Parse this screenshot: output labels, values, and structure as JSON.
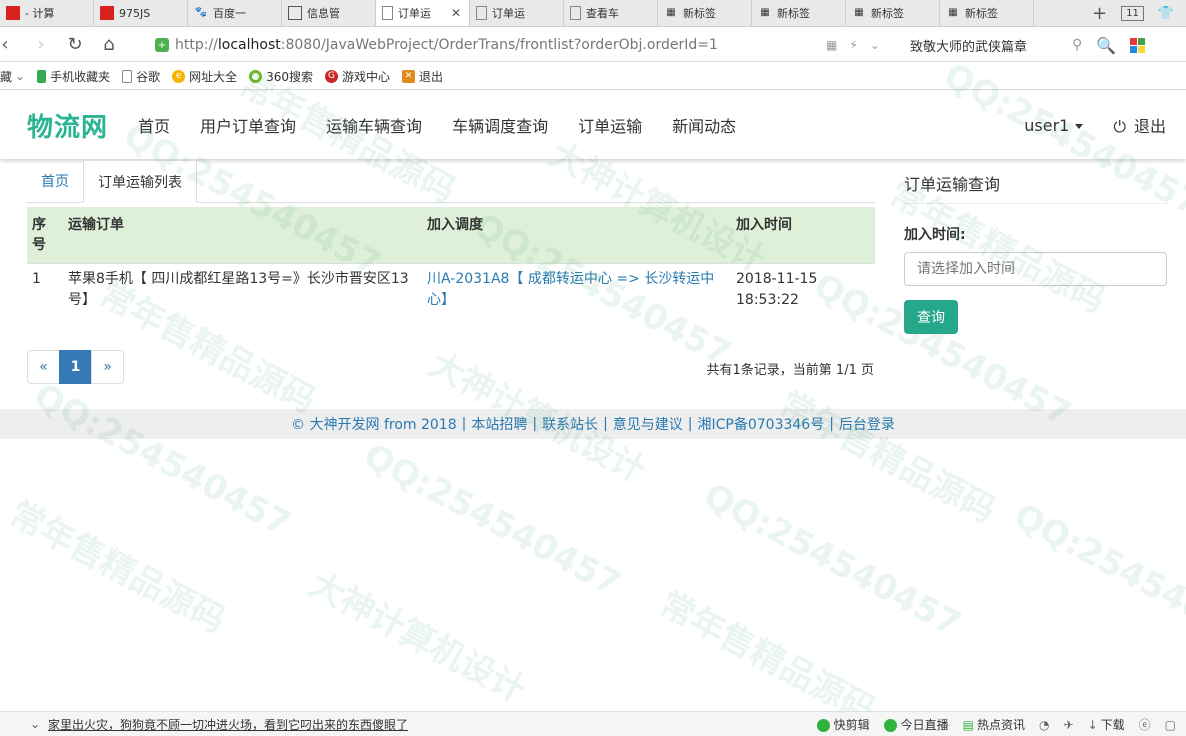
{
  "browser": {
    "tabs": [
      {
        "label": "- 计算",
        "icon": "red-flag-icon",
        "color": "#d9221f",
        "active": false
      },
      {
        "label": "975JS",
        "icon": "red-flag-icon",
        "color": "#d9221f",
        "active": false
      },
      {
        "label": "百度一",
        "icon": "baidu-paw-icon",
        "color": "#2f6ee8",
        "active": false
      },
      {
        "label": "信息管",
        "icon": "image-icon",
        "color": "#555555",
        "active": false
      },
      {
        "label": "订单运",
        "icon": "page-icon",
        "color": "#777777",
        "active": true
      },
      {
        "label": "订单运",
        "icon": "page-icon",
        "color": "#777777",
        "active": false
      },
      {
        "label": "查看车",
        "icon": "page-icon",
        "color": "#777777",
        "active": false
      },
      {
        "label": "新标签",
        "icon": "grid-icon",
        "color": "#555555",
        "active": false
      },
      {
        "label": "新标签",
        "icon": "grid-icon",
        "color": "#555555",
        "active": false
      },
      {
        "label": "新标签",
        "icon": "grid-icon",
        "color": "#555555",
        "active": false
      },
      {
        "label": "新标签",
        "icon": "grid-icon",
        "color": "#555555",
        "active": false
      }
    ],
    "tab_count": "11",
    "url_prefix": "http://",
    "url_host": "localhost",
    "url_rest": ":8080/JavaWebProject/OrderTrans/frontlist?orderObj.orderId=1",
    "search_hint": "致敬大师的武侠篇章",
    "bookmarks": [
      {
        "label": "藏",
        "icon": "star-icon"
      },
      {
        "label": "手机收藏夹",
        "icon": "phone-icon"
      },
      {
        "label": "谷歌",
        "icon": "page-icon"
      },
      {
        "label": "网址大全",
        "icon": "globe-icon"
      },
      {
        "label": "360搜索",
        "icon": "ring-icon"
      },
      {
        "label": "游戏中心",
        "icon": "game-icon"
      },
      {
        "label": "退出",
        "icon": "exit-icon"
      }
    ],
    "status_news": "家里出火灾，狗狗竟不顾一切冲进火场，看到它叼出来的东西傻眼了",
    "status_items": [
      "快剪辑",
      "今日直播",
      "热点资讯",
      "下载"
    ]
  },
  "site": {
    "brand": "物流网",
    "nav": [
      "首页",
      "用户订单查询",
      "运输车辆查询",
      "车辆调度查询",
      "订单运输",
      "新闻动态"
    ],
    "user": "user1",
    "logout": "退出"
  },
  "main": {
    "tabs": {
      "home": "首页",
      "current": "订单运输列表"
    },
    "columns": [
      "序号",
      "运输订单",
      "加入调度",
      "加入时间"
    ],
    "rows": [
      {
        "index": "1",
        "order": "苹果8手机【 四川成都红星路13号=》长沙市晋安区13号】",
        "dispatch": "川A-2031A8【 成都转运中心 => 长沙转运中心】",
        "time": "2018-11-15 18:53:22"
      }
    ],
    "pager": {
      "prev": "«",
      "current": "1",
      "next": "»"
    },
    "page_info": "共有1条记录，当前第 1/1 页"
  },
  "side": {
    "title": "订单运输查询",
    "label": "加入时间:",
    "placeholder": "请选择加入时间",
    "button": "查询"
  },
  "footer": {
    "links": [
      "© 大神开发网 from 2018",
      "本站招聘",
      "联系站长",
      "意见与建议",
      "湘ICP备0703346号",
      "后台登录"
    ]
  },
  "watermark": {
    "texts": [
      "QQ:254540457",
      "常年售精品源码",
      "大神计算机设计"
    ]
  }
}
